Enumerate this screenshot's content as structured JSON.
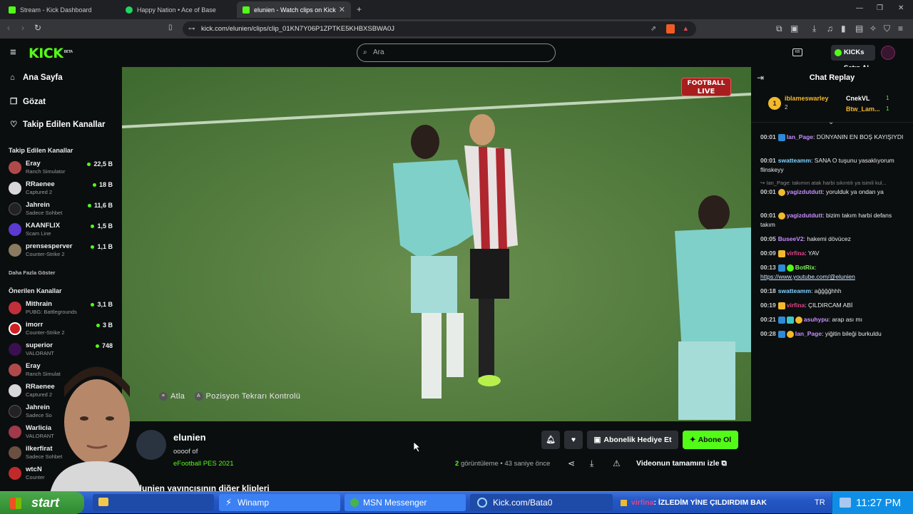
{
  "browser": {
    "tabs": [
      {
        "title": "Stream - Kick Dashboard"
      },
      {
        "title": "Happy Nation • Ace of Base"
      },
      {
        "title": "elunien - Watch clips on Kick"
      }
    ],
    "url": "kick.com/elunien/clips/clip_01KN7Y06P1ZPTKE5KHBXSBWA0J"
  },
  "header": {
    "logo": "KICK",
    "logo_tag": "BETA",
    "search_placeholder": "Ara",
    "kicks_button": "KICKs Satın Al"
  },
  "sidebar": {
    "nav": [
      {
        "label": "Ana Sayfa",
        "icon": "home-icon"
      },
      {
        "label": "Gözat",
        "icon": "browse-icon"
      },
      {
        "label": "Takip Edilen Kanallar",
        "icon": "heart-icon"
      }
    ],
    "followed_title": "Takip Edilen Kanallar",
    "followed": [
      {
        "name": "Eray",
        "game": "Ranch Simulator",
        "viewers": "22,5 B"
      },
      {
        "name": "RRaenee",
        "game": "Captured 2",
        "viewers": "18 B"
      },
      {
        "name": "Jahrein",
        "game": "Sadece Sohbet",
        "viewers": "11,6 B"
      },
      {
        "name": "KAANFLIX",
        "game": "Scam Line",
        "viewers": "1,5 B"
      },
      {
        "name": "prensesperver",
        "game": "Counter-Strike 2",
        "viewers": "1,1 B"
      }
    ],
    "show_more": "Daha Fazla Göster",
    "recommended_title": "Önerilen Kanallar",
    "recommended": [
      {
        "name": "Mithrain",
        "game": "PUBG: Battlegrounds",
        "viewers": "3,1 B"
      },
      {
        "name": "imorr",
        "game": "Counter-Strike 2",
        "viewers": "3 B"
      },
      {
        "name": "superior",
        "game": "VALORANT",
        "viewers": "748"
      },
      {
        "name": "Eray",
        "game": "Ranch Simulat",
        "viewers": ""
      },
      {
        "name": "RRaenee",
        "game": "Captured 2",
        "viewers": ""
      },
      {
        "name": "Jahrein",
        "game": "Sadece So",
        "viewers": ""
      },
      {
        "name": "Warlicia",
        "game": "VALORANT",
        "viewers": ""
      },
      {
        "name": "ilkerfirat",
        "game": "Sadece Sohbet",
        "viewers": ""
      },
      {
        "name": "wtcN",
        "game": "Counter",
        "viewers": ""
      }
    ]
  },
  "player": {
    "live_badge_top": "FOOTBALL",
    "live_badge_bottom": "LIVE",
    "hint_skip": "Atla",
    "hint_replay": "Pozisyon Tekrarı Kontrolü"
  },
  "clip": {
    "streamer": "elunien",
    "title": "oooof of",
    "game": "eFootball PES 2021",
    "gift_button": "Abonelik Hediye Et",
    "subscribe_button": "Abone Ol",
    "views_count": "2",
    "views_label": "görüntüleme",
    "time_ago": "43 saniye önce",
    "full_clip": "Videonun tamamını izle",
    "more_clips": "elunien yayıncısının diğer klipleri"
  },
  "chat": {
    "title": "Chat Replay",
    "pinned": [
      {
        "rank": "1",
        "user": "iblameswarley",
        "count": "2"
      },
      {
        "user": "CnekVL",
        "count": "1"
      },
      {
        "user": "Btw_Lam...",
        "count": "1"
      }
    ],
    "messages": [
      {
        "time": "00:01",
        "user": "Ian_Page",
        "color": "#c68dff",
        "text": "DÜNYANIN EN BOŞ KAYIŞIYDI"
      },
      {
        "time": "00:01",
        "user": "swatteamm",
        "color": "#7fd3ff",
        "text": "SANA O tuşunu yasaklıyorum flinskeyy"
      },
      {
        "time": "",
        "user": "",
        "color": "#888",
        "text": "Ian_Page: takımın atak harbi sıkıntılı ya isimli kul..."
      },
      {
        "time": "00:01",
        "user": "yagizdutdutt",
        "color": "#c68dff",
        "text": "yorulduk ya ondan ya"
      },
      {
        "time": "00:01",
        "user": "yagizdutdutt",
        "color": "#c68dff",
        "text": "bizim takım harbi defans takım"
      },
      {
        "time": "00:05",
        "user": "BuseeV2",
        "color": "#c68dff",
        "text": "hakemi dövücez"
      },
      {
        "time": "00:09",
        "user": "virfina",
        "color": "#e0468a",
        "text": "YAV"
      },
      {
        "time": "00:13",
        "user": "BotRix",
        "color": "#7cf55a",
        "text": "https://www.youtube.com/@elunien"
      },
      {
        "time": "00:18",
        "user": "swatteamm",
        "color": "#7fd3ff",
        "text": "ağğğğhhh"
      },
      {
        "time": "00:19",
        "user": "virfina",
        "color": "#e0468a",
        "text": "ÇILDIRCAM ABİ"
      },
      {
        "time": "00:21",
        "user": "asuhypu",
        "color": "#c68dff",
        "text": "arap ası mı"
      },
      {
        "time": "00:28",
        "user": "Ian_Page",
        "color": "#c68dff",
        "text": "yiğitin bileği burkuldu"
      }
    ]
  },
  "taskbar": {
    "start": "start",
    "items": [
      "Winamp",
      "MSN Messenger",
      "Kick.com/Bata0"
    ],
    "ticker_user": "virfina",
    "ticker_text": "İZLEDİM YİNE ÇILDIRDIM BAK",
    "lang": "TR",
    "clock": "11:27 PM"
  },
  "colors": {
    "brand": "#53fc18",
    "background": "#0b0e0f",
    "taskbar": "#2457c5"
  }
}
